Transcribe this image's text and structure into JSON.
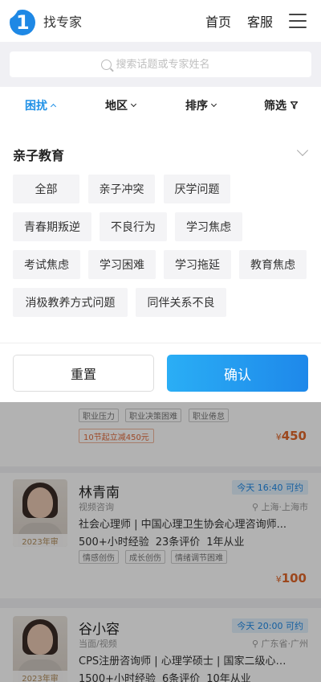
{
  "header": {
    "app_title": "找专家",
    "nav_home": "首页",
    "nav_service": "客服",
    "logo_char": "1"
  },
  "search": {
    "placeholder": "搜索话题或专家姓名"
  },
  "tabs": [
    {
      "label": "困扰",
      "active": true
    },
    {
      "label": "地区"
    },
    {
      "label": "排序"
    },
    {
      "label": "筛选"
    }
  ],
  "panel": {
    "title": "亲子教育",
    "tags": [
      "全部",
      "亲子冲突",
      "厌学问题",
      "青春期叛逆",
      "不良行为",
      "学习焦虑",
      "考试焦虑",
      "学习困难",
      "学习拖延",
      "教育焦虑",
      "消极教养方式问题",
      "同伴关系不良"
    ],
    "reset_label": "重置",
    "confirm_label": "确认"
  },
  "colors": {
    "accent": "#1e90e6",
    "confirm_start": "#2aaef5",
    "confirm_end": "#1e88ea",
    "price": "#e0662a"
  },
  "cards": [
    {
      "tags": [
        "职业压力",
        "职业决策困难",
        "职业倦怠"
      ],
      "promo": "10节起立减450元",
      "price_symbol": "¥",
      "price": "450"
    },
    {
      "name": "林青南",
      "mode": "视频咨询",
      "availability": "今天 16:40 可约",
      "location": "上海·上海市",
      "year": "2023年审",
      "credentials": "社会心理师 | 中国心理卫生协会心理咨询师...",
      "stats": [
        "500+小时经验",
        "23条评价",
        "1年从业"
      ],
      "tags": [
        "情感创伤",
        "成长创伤",
        "情绪调节困难"
      ],
      "price_symbol": "¥",
      "price": "100"
    },
    {
      "name": "谷小容",
      "mode": "当面/视频",
      "availability": "今天 20:00 可约",
      "location": "广东省·广州",
      "year": "2023年审",
      "credentials": "CPS注册咨询师 | 心理学硕士 | 国家二级心理...",
      "stats": [
        "1500+小时经验",
        "6条评价",
        "10年从业"
      ]
    }
  ]
}
